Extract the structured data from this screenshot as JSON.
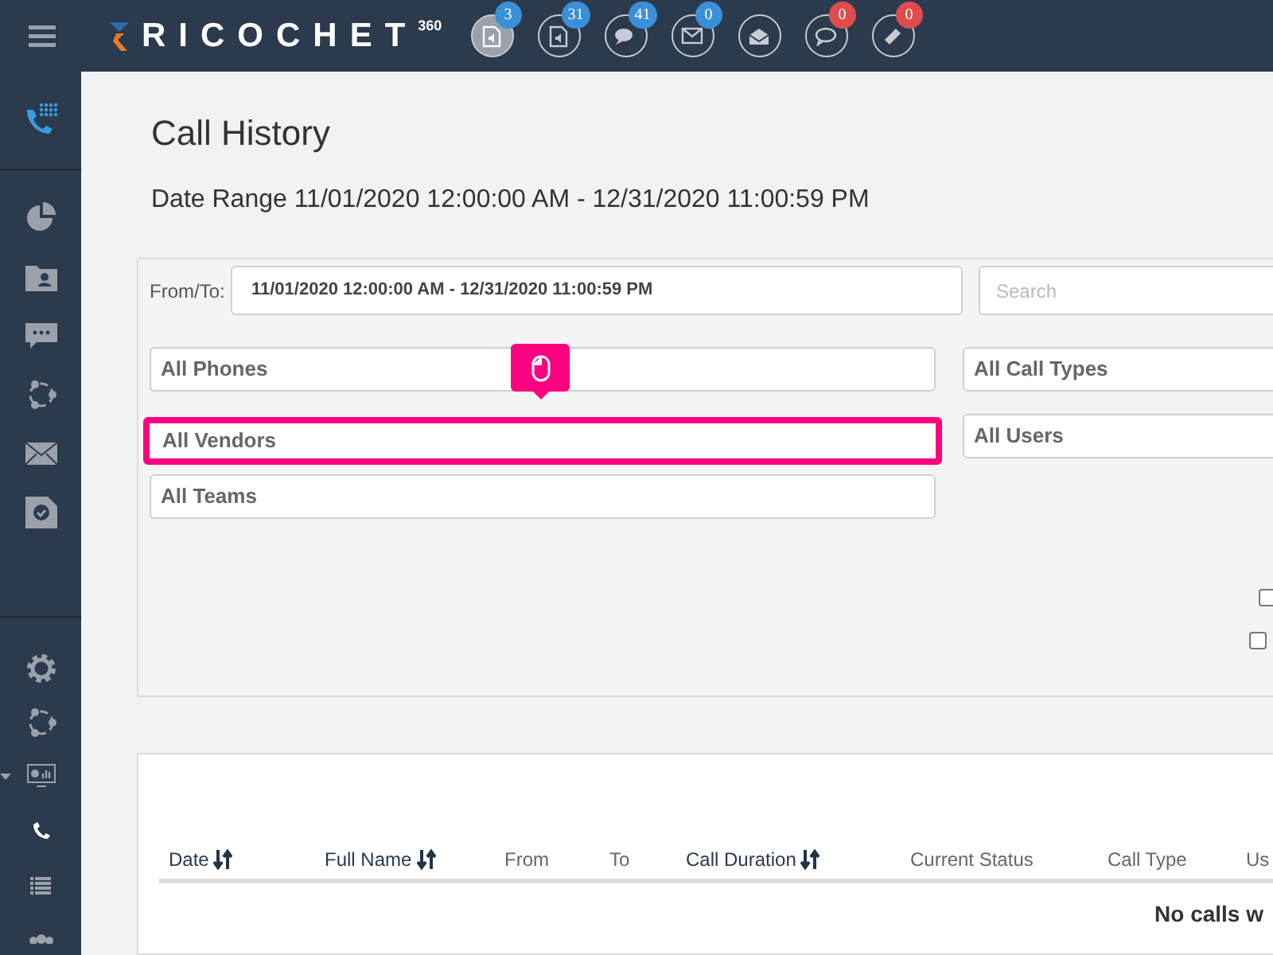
{
  "brand": {
    "name": "RICOCHET",
    "superscript": "360"
  },
  "header_icons": [
    {
      "kind": "voicemail",
      "selected": true,
      "badge": "3",
      "color": "#3a8fd9"
    },
    {
      "kind": "voicemail",
      "selected": false,
      "badge": "31",
      "color": "#3a8fd9"
    },
    {
      "kind": "chat",
      "selected": false,
      "badge": "41",
      "color": "#3a8fd9"
    },
    {
      "kind": "mail",
      "selected": false,
      "badge": "0",
      "color": "#3a8fd9"
    },
    {
      "kind": "open-mail",
      "selected": false
    },
    {
      "kind": "comment",
      "selected": false,
      "badge": "0",
      "color": "#e04c4c"
    },
    {
      "kind": "ticket",
      "selected": false,
      "badge": "0",
      "color": "#e04c4c"
    }
  ],
  "sidebar": {
    "groups": [
      [
        {
          "kind": "dialpad"
        }
      ],
      [
        {
          "kind": "pie",
          "selected": false
        },
        {
          "kind": "contact",
          "selected": false
        },
        {
          "kind": "chat",
          "selected": false
        },
        {
          "kind": "share",
          "selected": false
        },
        {
          "kind": "mail",
          "selected": false
        },
        {
          "kind": "task",
          "selected": false
        }
      ],
      [
        {
          "kind": "gear",
          "selected": false
        },
        {
          "kind": "share",
          "selected": false
        },
        {
          "kind": "monitor",
          "selected": false,
          "expanded": true
        },
        {
          "kind": "phone",
          "selected": true
        },
        {
          "kind": "list",
          "selected": false
        },
        {
          "kind": "people",
          "selected": false
        }
      ]
    ]
  },
  "page": {
    "title": "Call History",
    "date_range": "Date Range 11/01/2020 12:00:00 AM - 12/31/2020 11:00:59 PM"
  },
  "filters": {
    "from_to_label": "From/To:",
    "from_to_value": "11/01/2020 12:00:00 AM - 12/31/2020 11:00:59 PM",
    "search_placeholder": "Search",
    "left": [
      {
        "label": "All Phones",
        "highlighted": false
      },
      {
        "label": "All Vendors",
        "highlighted": true
      },
      {
        "label": "All Teams",
        "highlighted": false
      }
    ],
    "right": [
      {
        "label": "All Call Types",
        "highlighted": false
      },
      {
        "label": "All Users",
        "highlighted": false
      }
    ],
    "checkboxes": [
      {
        "checked": false
      },
      {
        "checked": false
      }
    ]
  },
  "table": {
    "columns": [
      {
        "label": "Date",
        "sortable": true
      },
      {
        "label": "Full Name",
        "sortable": true
      },
      {
        "label": "From",
        "sortable": false
      },
      {
        "label": "To",
        "sortable": false
      },
      {
        "label": "Call Duration",
        "sortable": true
      },
      {
        "label": "Current Status",
        "sortable": false
      },
      {
        "label": "Call Type",
        "sortable": false
      },
      {
        "label": "Us",
        "sortable": false
      }
    ],
    "empty_message": "No calls w"
  }
}
